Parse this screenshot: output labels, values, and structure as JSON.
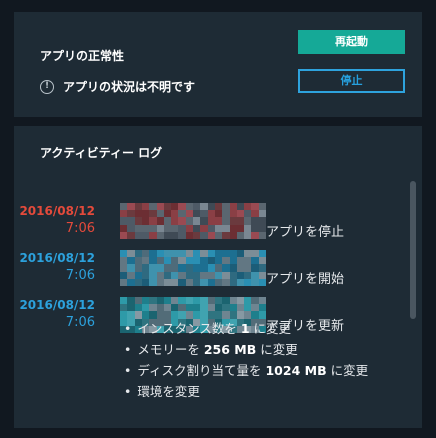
{
  "health": {
    "title": "アプリの正常性",
    "status_icon": "info-icon",
    "status_text": "アプリの状況は不明です",
    "restart_label": "再起動",
    "stop_label": "停止"
  },
  "activity": {
    "title": "アクティビティー ログ",
    "entries": [
      {
        "date": "2016/08/12",
        "time": "7:06",
        "action": "アプリを停止",
        "tone": "red"
      },
      {
        "date": "2016/08/12",
        "time": "7:06",
        "action": "アプリを開始",
        "tone": "blue"
      },
      {
        "date": "2016/08/12",
        "time": "7:06",
        "action": "アプリを更新",
        "tone": "blue"
      }
    ],
    "changes": [
      {
        "before": "インスタンス数を ",
        "bold": "1",
        "after": " に変更"
      },
      {
        "before": "メモリーを ",
        "bold": "256 MB",
        "after": " に変更"
      },
      {
        "before": "ディスク割り当て量を ",
        "bold": "1024 MB",
        "after": " に変更"
      },
      {
        "before": "環境を変更",
        "bold": "",
        "after": ""
      }
    ]
  },
  "colors": {
    "background": "#111820",
    "panel": "#1e2b35",
    "accent_green": "#15a997",
    "accent_blue": "#2ca1dc",
    "error_red": "#e44a3b"
  }
}
